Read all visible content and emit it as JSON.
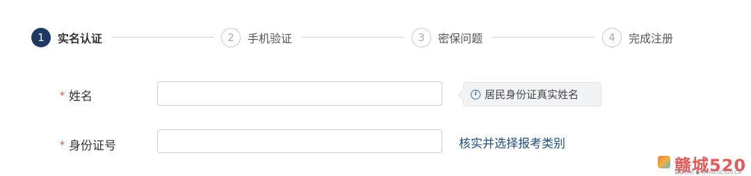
{
  "steps": [
    {
      "number": "1",
      "label": "实名认证",
      "state": "active"
    },
    {
      "number": "2",
      "label": "手机验证",
      "state": "inactive"
    },
    {
      "number": "3",
      "label": "密保问题",
      "state": "inactive"
    },
    {
      "number": "4",
      "label": "完成注册",
      "state": "inactive"
    }
  ],
  "form": {
    "required_mark": "*",
    "name_label": "姓名",
    "name_value": "",
    "name_placeholder": "",
    "name_hint": "居民身份证真实姓名",
    "id_label": "身份证号",
    "id_value": "",
    "id_placeholder": "",
    "verify_link": "核实并选择报考类别"
  },
  "colors": {
    "accent": "#1e3a64",
    "required": "#e0463a",
    "link": "#1f4d86"
  },
  "icons": {
    "hint_icon": "info-icon"
  },
  "watermark": {
    "text": "赣城520",
    "subtitle": "最新资讯 ● WWW.GC520.CN"
  }
}
